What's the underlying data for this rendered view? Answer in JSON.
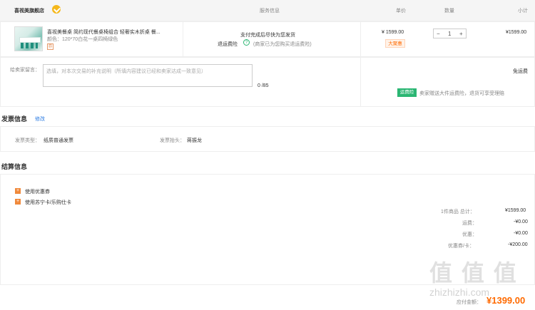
{
  "shop": {
    "name": "喜视美旗舰店",
    "icon": "shop-verified-icon"
  },
  "table_headers": {
    "service": "服务信息",
    "price": "单价",
    "quantity": "数量",
    "subtotal": "小计"
  },
  "product": {
    "title": "喜视美餐桌 简约现代餐桌椅组合 轻奢实木折桌 餐...",
    "spec": "颜色：120*70白花一桌四椅绿色",
    "ticket_icon": "券",
    "service_line1": "支付完成后尽快为您发货",
    "insurance_label": "退运费险",
    "insurance_note": "(商家已为您购买退运费险)",
    "price": "¥ 1599.00",
    "promo_tag": "大聚惠",
    "qty": "1",
    "qty_minus": "−",
    "qty_plus": "+",
    "subtotal": "¥1599.00"
  },
  "note": {
    "label": "给卖家留言：",
    "placeholder": "选填，对本次交易的补充说明（所填内容建议已经和卖家达成一致意见）",
    "counter": "0 /85"
  },
  "shipping": {
    "free": "免运费",
    "badge": "运费险",
    "text": "卖家赠送大件运费险，退货可享受理赔"
  },
  "invoice": {
    "title": "发票信息",
    "edit": "修改",
    "type_label": "发票类型：",
    "type_value": "纸质普通发票",
    "header_label": "发票抬头：",
    "header_value": "蒋振龙"
  },
  "settlement": {
    "title": "结算信息",
    "coupon": "使用优惠券",
    "card": "使用苏宁卡/乐购仕卡",
    "rows": [
      {
        "label": "1件商品 总计：",
        "value": "¥1599.00"
      },
      {
        "label": "运费：",
        "value": "-¥0.00"
      },
      {
        "label": "优惠：",
        "value": "-¥0.00"
      },
      {
        "label": "优惠券/卡：",
        "value": "-¥200.00"
      }
    ],
    "total_label": "应付金额：",
    "total_value": "¥1399.00"
  },
  "watermark": {
    "big": "值 值 值",
    "small": "zhizhizhi.com"
  },
  "colors": {
    "accent": "#ff6a00",
    "green": "#2bb673",
    "gold": "#f5b81b",
    "link": "#2a7ae2"
  }
}
